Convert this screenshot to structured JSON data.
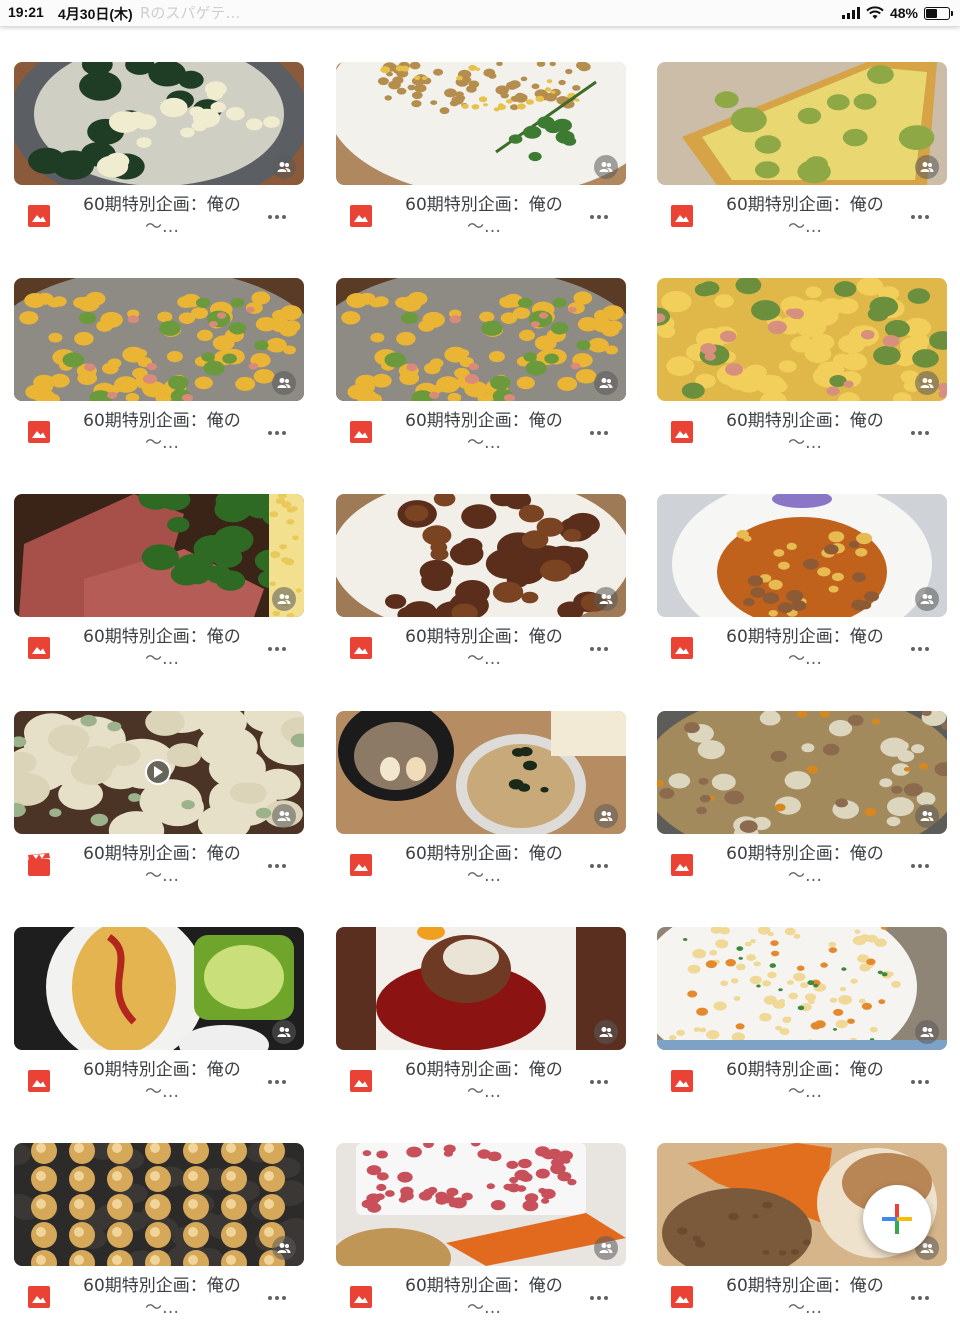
{
  "status_bar": {
    "time": "19:21",
    "date": "4月30日(木)",
    "behind_text": "Rのスパゲテ…",
    "battery": "48%"
  },
  "colors": {
    "accent_red": "#ea4335",
    "text_gray": "#3c4043"
  },
  "files": [
    {
      "title_line1": "60期特別企画：俺の",
      "title_line2": "〜…",
      "type": "image-icon",
      "thumb": "soup"
    },
    {
      "title_line1": "60期特別企画：俺の",
      "title_line2": "〜…",
      "type": "image-icon",
      "thumb": "fried-rice"
    },
    {
      "title_line1": "60期特別企画：俺の",
      "title_line2": "〜…",
      "type": "image-icon",
      "thumb": "toast"
    },
    {
      "title_line1": "60期特別企画：俺の",
      "title_line2": "〜…",
      "type": "image-icon",
      "thumb": "macaroni"
    },
    {
      "title_line1": "60期特別企画：俺の",
      "title_line2": "〜…",
      "type": "image-icon",
      "thumb": "macaroni"
    },
    {
      "title_line1": "60期特別企画：俺の",
      "title_line2": "〜…",
      "type": "image-icon",
      "thumb": "macaroni-close"
    },
    {
      "title_line1": "60期特別企画：俺の",
      "title_line2": "〜…",
      "type": "image-icon",
      "thumb": "roast-beef"
    },
    {
      "title_line1": "60期特別企画：俺の",
      "title_line2": "〜…",
      "type": "image-icon",
      "thumb": "karaage"
    },
    {
      "title_line1": "60期特別企画：俺の",
      "title_line2": "〜…",
      "type": "image-icon",
      "thumb": "stew"
    },
    {
      "title_line1": "60期特別企画：俺の",
      "title_line2": "〜…",
      "type": "video-icon",
      "thumb": "gyoza"
    },
    {
      "title_line1": "60期特別企画：俺の",
      "title_line2": "〜…",
      "type": "image-icon",
      "thumb": "noodles"
    },
    {
      "title_line1": "60期特別企画：俺の",
      "title_line2": "〜…",
      "type": "image-icon",
      "thumb": "pork-soup"
    },
    {
      "title_line1": "60期特別企画：俺の",
      "title_line2": "〜…",
      "type": "image-icon",
      "thumb": "omurice"
    },
    {
      "title_line1": "60期特別企画：俺の",
      "title_line2": "〜…",
      "type": "image-icon",
      "thumb": "hamburg"
    },
    {
      "title_line1": "60期特別企画：俺の",
      "title_line2": "〜…",
      "type": "image-icon",
      "thumb": "fried-rice-2"
    },
    {
      "title_line1": "60期特別企画：俺の",
      "title_line2": "〜…",
      "type": "image-icon",
      "thumb": "takoyaki"
    },
    {
      "title_line1": "60期特別企画：俺の",
      "title_line2": "〜…",
      "type": "image-icon",
      "thumb": "minced-meat"
    },
    {
      "title_line1": "60期特別企画：俺の",
      "title_line2": "〜…",
      "type": "image-icon",
      "thumb": "vegetables"
    }
  ],
  "fab": {
    "icon": "plus-icon"
  }
}
